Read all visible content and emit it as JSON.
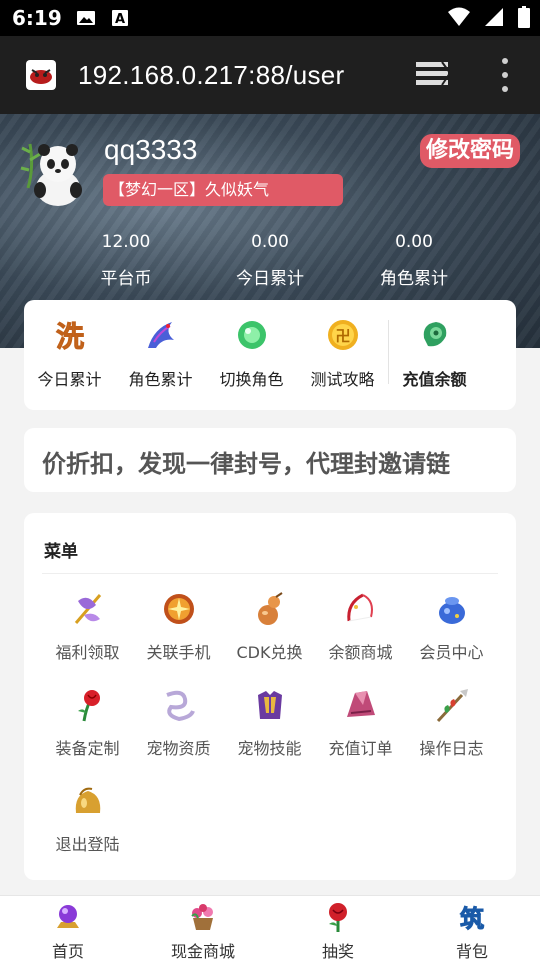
{
  "status_bar": {
    "time": "6:19"
  },
  "browser": {
    "url": "192.168.0.217:88/user"
  },
  "profile": {
    "username": "qq3333",
    "server": "【梦幻一区】久似妖气",
    "change_password": "修改密码",
    "stats": [
      {
        "value": "12.00",
        "label": "平台币"
      },
      {
        "value": "0.00",
        "label": "今日累计"
      },
      {
        "value": "0.00",
        "label": "角色累计"
      }
    ]
  },
  "quick_actions": [
    {
      "label": "今日累计",
      "icon": "wash-icon"
    },
    {
      "label": "角色累计",
      "icon": "blue-dragon-icon"
    },
    {
      "label": "切换角色",
      "icon": "green-orb-icon"
    },
    {
      "label": "测试攻略",
      "icon": "gold-coin-icon"
    },
    {
      "label": "充值余额",
      "icon": "jade-icon"
    }
  ],
  "notice": "价折扣，发现一律封号，代理封邀请链",
  "menu": {
    "title": "菜单",
    "items": [
      {
        "label": "福利领取",
        "icon": "gift-staff-icon"
      },
      {
        "label": "关联手机",
        "icon": "orange-token-icon"
      },
      {
        "label": "CDK兑换",
        "icon": "gourd-icon"
      },
      {
        "label": "余额商城",
        "icon": "red-bow-icon"
      },
      {
        "label": "会员中心",
        "icon": "blue-pot-icon"
      },
      {
        "label": "装备定制",
        "icon": "rose-icon"
      },
      {
        "label": "宠物资质",
        "icon": "ribbon-icon"
      },
      {
        "label": "宠物技能",
        "icon": "armor-icon"
      },
      {
        "label": "充值订单",
        "icon": "pink-robe-icon"
      },
      {
        "label": "操作日志",
        "icon": "spear-icon"
      },
      {
        "label": "退出登陆",
        "icon": "gold-bell-icon"
      }
    ]
  },
  "bottom_nav": [
    {
      "label": "首页",
      "icon": "crystal-ball-icon"
    },
    {
      "label": "现金商城",
      "icon": "flower-basket-icon"
    },
    {
      "label": "抽奖",
      "icon": "red-rose-icon"
    },
    {
      "label": "背包",
      "icon": "blue-glyph-icon"
    }
  ]
}
